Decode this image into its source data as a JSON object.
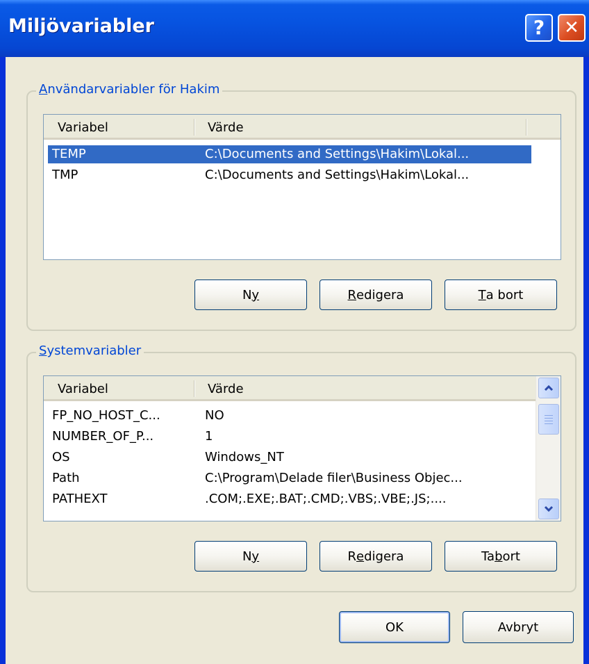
{
  "window": {
    "title": "Miljövariabler",
    "help_glyph": "?",
    "close_glyph": "✕"
  },
  "user_group": {
    "legend_prefix": "A",
    "legend_rest": "nvändarvariabler för Hakim",
    "columns": [
      "Variabel",
      "Värde"
    ],
    "rows": [
      {
        "name": "TEMP",
        "value": "C:\\Documents and Settings\\Hakim\\Lokal...",
        "selected": true
      },
      {
        "name": "TMP",
        "value": "C:\\Documents and Settings\\Hakim\\Lokal...",
        "selected": false
      }
    ],
    "buttons": {
      "new": {
        "before": "N",
        "accel": "y",
        "after": ""
      },
      "edit": {
        "before": "",
        "accel": "R",
        "after": "edigera"
      },
      "delete": {
        "before": "",
        "accel": "T",
        "after": "a bort"
      }
    }
  },
  "system_group": {
    "legend_prefix": "S",
    "legend_rest": "ystemvariabler",
    "columns": [
      "Variabel",
      "Värde"
    ],
    "rows": [
      {
        "name": "FP_NO_HOST_C...",
        "value": "NO"
      },
      {
        "name": "NUMBER_OF_P...",
        "value": "1"
      },
      {
        "name": "OS",
        "value": "Windows_NT"
      },
      {
        "name": "Path",
        "value": "C:\\Program\\Delade filer\\Business Objec..."
      },
      {
        "name": "PATHEXT",
        "value": ".COM;.EXE;.BAT;.CMD;.VBS;.VBE;.JS;...."
      }
    ],
    "buttons": {
      "new": {
        "before": "N",
        "accel": "y",
        "after": ""
      },
      "edit": {
        "before": "R",
        "accel": "e",
        "after": "digera"
      },
      "delete": {
        "before": "Ta ",
        "accel": "b",
        "after": "ort"
      }
    }
  },
  "footer": {
    "ok_label": "OK",
    "cancel_label": "Avbryt"
  },
  "colors": {
    "title_bar": "#0753e0",
    "dialog_bg": "#ece9d8",
    "legend_text": "#0046d5",
    "selection": "#316ac5"
  }
}
